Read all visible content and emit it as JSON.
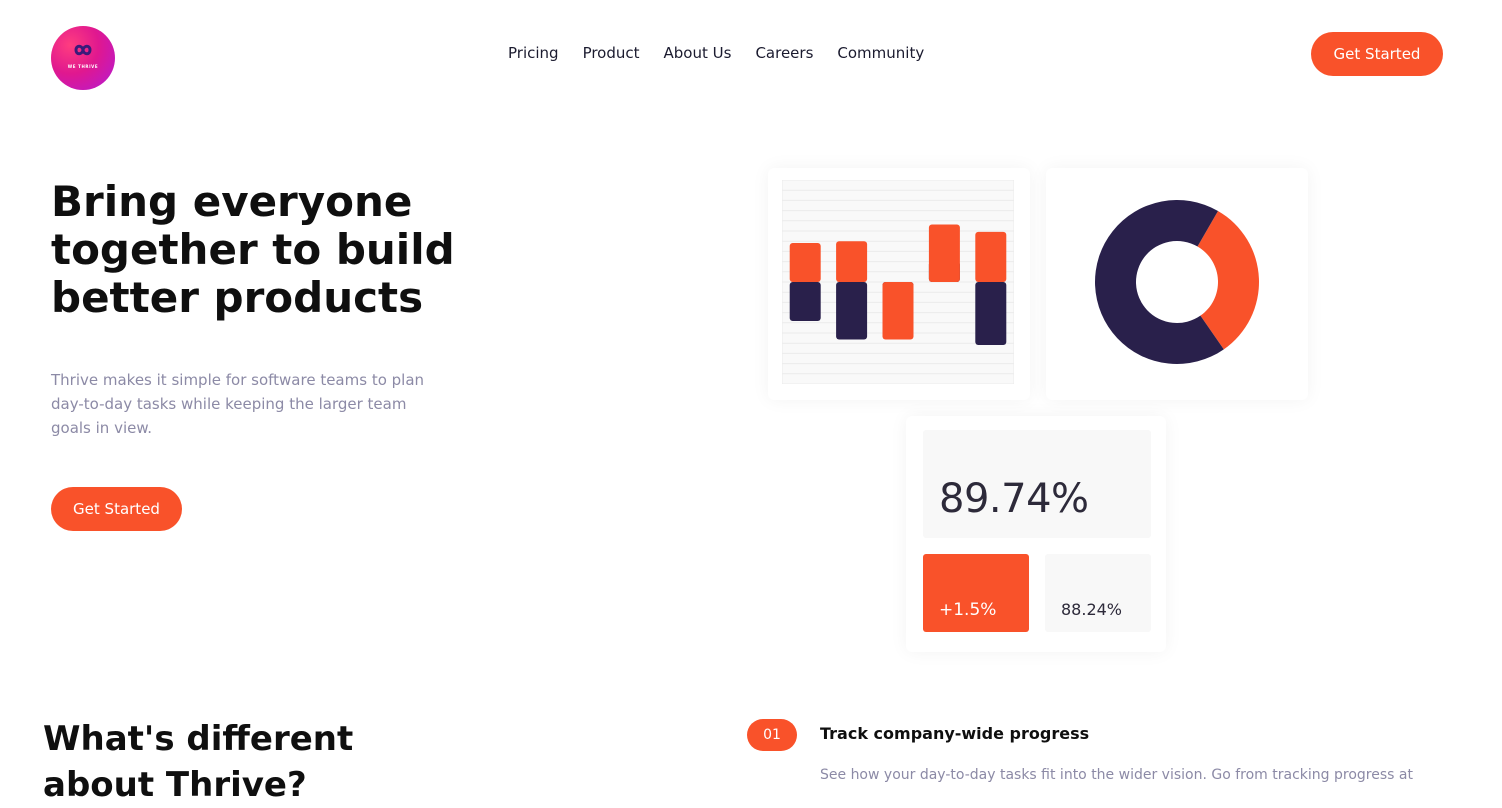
{
  "brand": {
    "logo_text": "WE THRIVE",
    "accent": "#f9522a",
    "navy": "#29204b"
  },
  "nav": {
    "items": [
      "Pricing",
      "Product",
      "About Us",
      "Careers",
      "Community"
    ]
  },
  "header": {
    "cta_label": "Get Started"
  },
  "hero": {
    "title": "Bring everyone together to build better products",
    "description": "Thrive makes it simple for software teams to plan day-to-day tasks while keeping the larger team goals in view.",
    "cta_label": "Get Started"
  },
  "chart_data": [
    {
      "type": "bar",
      "series": [
        {
          "name": "",
          "color": "#f9522a",
          "values": [
            2.1,
            2.2,
            -3.1,
            3.1,
            2.7
          ]
        },
        {
          "name": "",
          "color": "#29204b",
          "values": [
            -2.1,
            -3.1,
            -2.1,
            1.1,
            -3.4
          ]
        }
      ],
      "ylim": [
        -5.5,
        5.5
      ],
      "grid": true
    },
    {
      "type": "pie",
      "style": "donut",
      "values": [
        32,
        68
      ],
      "colors": [
        "#f9522a",
        "#29204b"
      ]
    }
  ],
  "stats": {
    "main": "89.74%",
    "change": "+1.5%",
    "secondary": "88.24%"
  },
  "section": {
    "title": "What's different about Thrive?"
  },
  "features": [
    {
      "number": "01",
      "title": "Track company-wide progress",
      "description": "See how your day-to-day tasks fit into the wider vision. Go from tracking progress at"
    }
  ]
}
